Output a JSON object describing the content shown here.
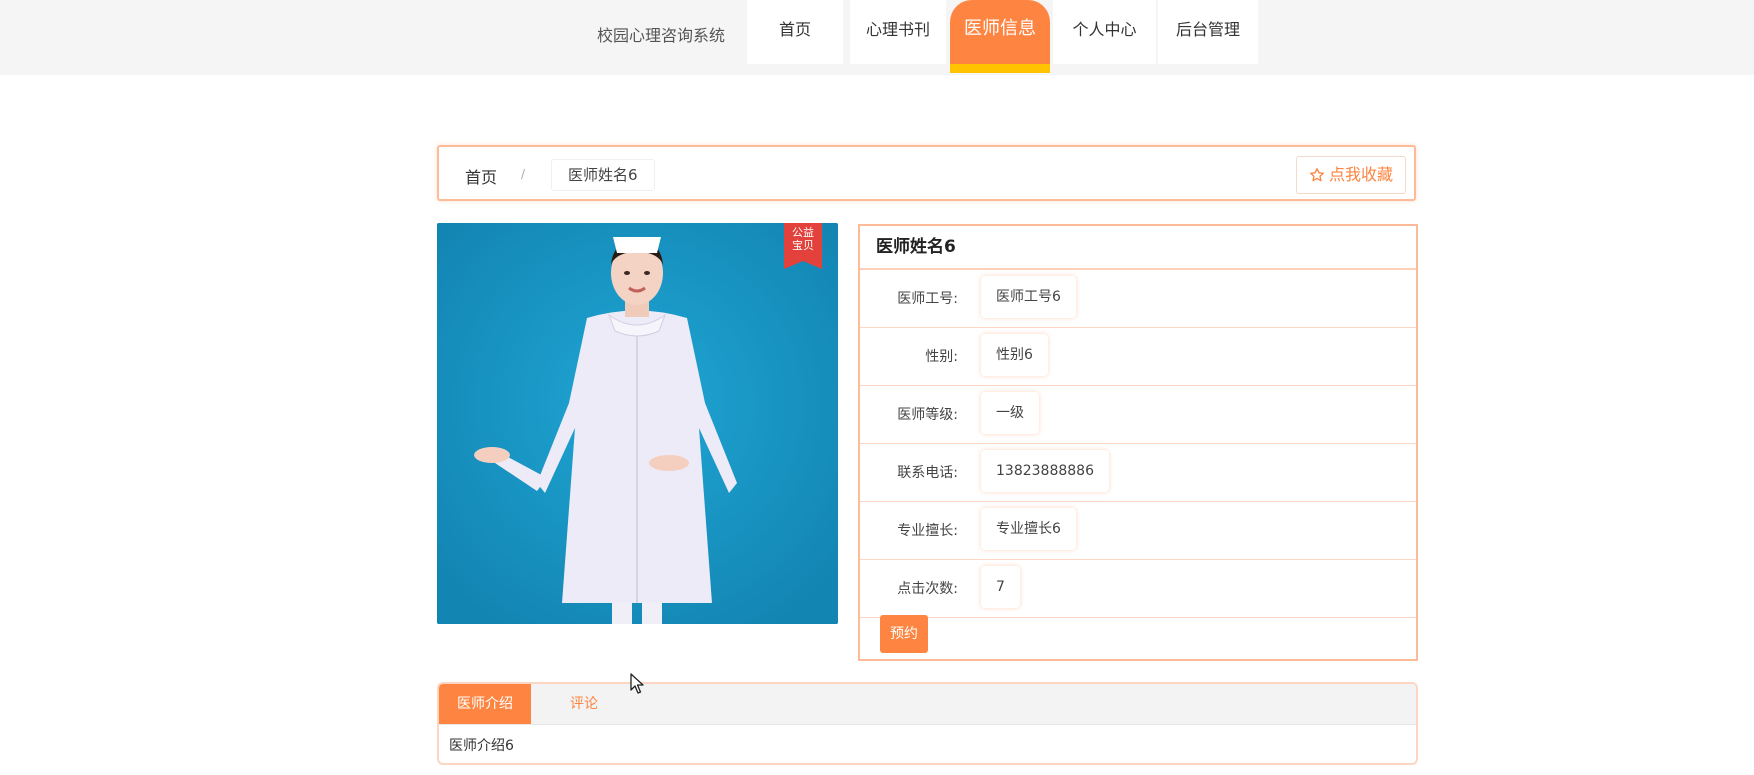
{
  "nav": {
    "site_title": "校园心理咨询系统",
    "items": [
      {
        "label": "首页"
      },
      {
        "label": "心理书刊"
      },
      {
        "label": "医师信息",
        "active": true
      },
      {
        "label": "个人中心"
      },
      {
        "label": "后台管理"
      }
    ]
  },
  "breadcrumb": {
    "home": "首页",
    "separator": "/",
    "current": "医师姓名6"
  },
  "favorite_button": "点我收藏",
  "photo": {
    "badge_line1": "公益",
    "badge_line2": "宝贝"
  },
  "detail": {
    "title": "医师姓名6",
    "rows": [
      {
        "label": "医师工号:",
        "value": "医师工号6"
      },
      {
        "label": "性别:",
        "value": "性别6"
      },
      {
        "label": "医师等级:",
        "value": "一级"
      },
      {
        "label": "联系电话:",
        "value": "13823888886"
      },
      {
        "label": "专业擅长:",
        "value": "专业擅长6"
      },
      {
        "label": "点击次数:",
        "value": "7"
      }
    ],
    "book_button": "预约"
  },
  "tabs": {
    "items": [
      "医师介绍",
      "评论"
    ],
    "content": "医师介绍6"
  },
  "colors": {
    "accent": "#fd8541",
    "active_underline": "#ffc300",
    "border": "#fdbb9a",
    "badge": "#e2413c",
    "photo_bg": "#1a95c4"
  }
}
